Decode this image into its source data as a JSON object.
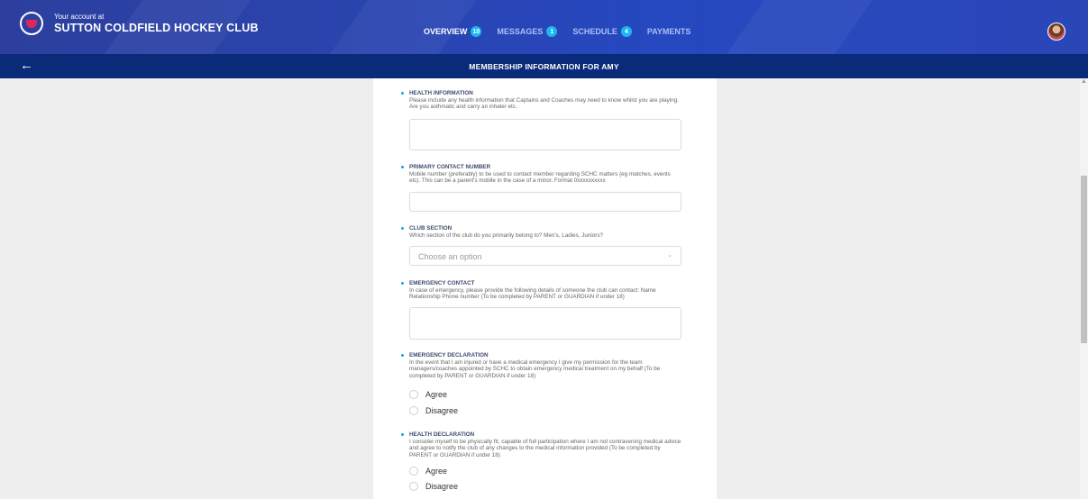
{
  "header": {
    "account_label": "Your account at",
    "club_name": "SUTTON COLDFIELD HOCKEY CLUB",
    "nav": [
      {
        "label": "OVERVIEW",
        "badge": "10",
        "active": true
      },
      {
        "label": "MESSAGES",
        "badge": "1",
        "active": false
      },
      {
        "label": "SCHEDULE",
        "badge": "4",
        "active": false
      },
      {
        "label": "PAYMENTS",
        "badge": "",
        "active": false
      }
    ]
  },
  "subheader": {
    "back_icon": "←",
    "title": "MEMBERSHIP INFORMATION FOR AMY"
  },
  "form": {
    "health_information": {
      "label": "HEALTH INFORMATION",
      "description": "Please include any health information that Captains and Coaches may need to know whilst you are playing. Are you asthmatic and carry an inhaler etc.",
      "value": ""
    },
    "primary_contact": {
      "label": "PRIMARY CONTACT NUMBER",
      "description": "Mobile number (preferably) to be used to contact member regarding SCHC matters (eg matches, events etc). This can be a parent's mobile in the case of a minor. Format 0xxxxxxxxxx",
      "value": ""
    },
    "club_section": {
      "label": "CLUB SECTION",
      "description": "Which section of the club do you primarily belong to? Men's, Ladies, Juniors?",
      "placeholder": "Choose an option"
    },
    "emergency_contact": {
      "label": "EMERGENCY CONTACT",
      "description": "In case of emergency, please provide the following details of someone the club can contact: Name Relationship Phone number (To be completed by PARENT or GUARDIAN if under 18)",
      "value": ""
    },
    "emergency_declaration": {
      "label": "EMERGENCY DECLARATION",
      "description": "In the event that I am injured or have a medical emergency I give my permission for the team managers/coaches appointed by SCHC to obtain emergency medical treatment on my behalf (To be completed by PARENT or GUARDIAN if under 18)",
      "options": [
        "Agree",
        "Disagree"
      ]
    },
    "health_declaration": {
      "label": "HEALTH DECLARATION",
      "description": "I consider myself to be physically fit, capable of full participation where I am not contravening medical advice and agree to notify the club of any changes to the medical information provided (To be completed by PARENT or GUARDIAN if under 18)",
      "options": [
        "Agree",
        "Disagree"
      ]
    }
  },
  "colors": {
    "header_bg": "#2a44b0",
    "subheader_bg": "#0a2a7a",
    "badge": "#19b8f0",
    "accent_red": "#e0245e"
  }
}
